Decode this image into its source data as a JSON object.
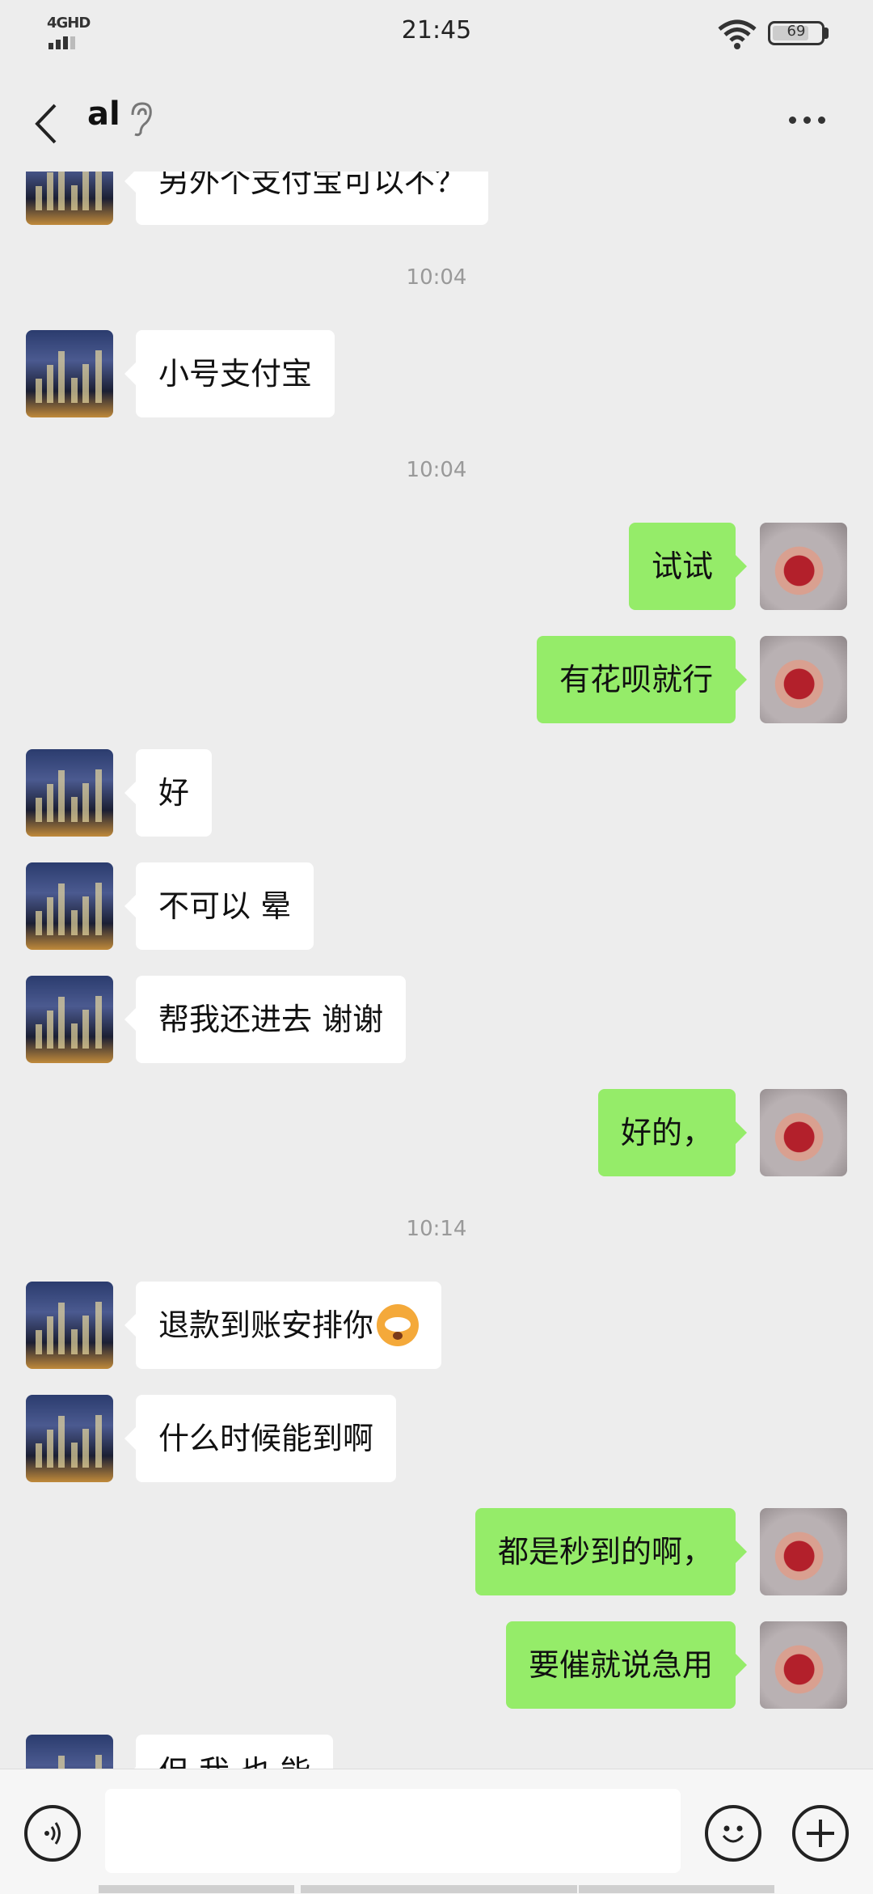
{
  "status_bar": {
    "network": "4GHD",
    "time": "21:45",
    "battery": "69",
    "battery_level_percent": 69
  },
  "header": {
    "title": "al",
    "back_icon": "chevron-left-icon",
    "ear_icon": "ear-icon",
    "more_icon": "more-dots-icon"
  },
  "messages": [
    {
      "side": "in",
      "text": "另外个支付宝可以不？"
    },
    {
      "timestamp": "10:04"
    },
    {
      "side": "in",
      "text": "小号支付宝"
    },
    {
      "timestamp": "10:04"
    },
    {
      "side": "out",
      "text": "试试"
    },
    {
      "side": "out",
      "text": "有花呗就行"
    },
    {
      "side": "in",
      "text": "好"
    },
    {
      "side": "in",
      "text": "不可以 晕"
    },
    {
      "side": "in",
      "text": "帮我还进去 谢谢"
    },
    {
      "side": "out",
      "text": "好的，"
    },
    {
      "timestamp": "10:14"
    },
    {
      "side": "in",
      "text": "退款到账安排你",
      "emoji": "flushed-face-emoji"
    },
    {
      "side": "in",
      "text": "什么时候能到啊"
    },
    {
      "side": "out",
      "text": "都是秒到的啊，"
    },
    {
      "side": "out",
      "text": "要催就说急用"
    },
    {
      "side": "in",
      "text": "但 我 也 能"
    }
  ],
  "input_bar": {
    "value": "",
    "voice_icon": "voice-icon",
    "emoji_icon": "smiley-icon",
    "plus_icon": "plus-icon"
  },
  "colors": {
    "background": "#ededed",
    "incoming_bubble": "#ffffff",
    "outgoing_bubble": "#95ec69",
    "timestamp_text": "#999999"
  }
}
